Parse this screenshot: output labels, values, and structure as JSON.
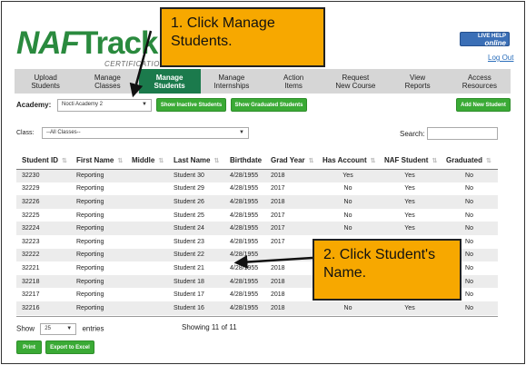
{
  "header": {
    "logo_naf": "NAF",
    "logo_track": "Track",
    "certification": "CERTIFICATION",
    "help_top": "LIVE HELP",
    "help_bottom": "online",
    "logout": "Log Out"
  },
  "nav": [
    {
      "line1": "Upload",
      "line2": "Students"
    },
    {
      "line1": "Manage",
      "line2": "Classes"
    },
    {
      "line1": "Manage",
      "line2": "Students",
      "active": true
    },
    {
      "line1": "Manage",
      "line2": "Internships"
    },
    {
      "line1": "Action",
      "line2": "Items"
    },
    {
      "line1": "Request",
      "line2": "New Course"
    },
    {
      "line1": "View",
      "line2": "Reports"
    },
    {
      "line1": "Access",
      "line2": "Resources"
    }
  ],
  "academy": {
    "label": "Academy:",
    "selected": "Nocti Academy 2",
    "show_inactive": "Show Inactive Students",
    "show_graduated": "Show Graduated Students",
    "add_new": "Add New Student"
  },
  "filters": {
    "class_label": "Class:",
    "class_selected": "--All Classes--",
    "search_label": "Search:"
  },
  "table": {
    "columns": [
      "Student ID",
      "First Name",
      "Middle",
      "Last Name",
      "Birthdate",
      "Grad Year",
      "Has Account",
      "NAF Student",
      "Graduated"
    ],
    "rows": [
      [
        "32230",
        "Reporting",
        "",
        "Student 30",
        "4/28/1955",
        "2018",
        "Yes",
        "Yes",
        "No"
      ],
      [
        "32229",
        "Reporting",
        "",
        "Student 29",
        "4/28/1955",
        "2017",
        "No",
        "Yes",
        "No"
      ],
      [
        "32226",
        "Reporting",
        "",
        "Student 26",
        "4/28/1955",
        "2018",
        "No",
        "Yes",
        "No"
      ],
      [
        "32225",
        "Reporting",
        "",
        "Student 25",
        "4/28/1955",
        "2017",
        "No",
        "Yes",
        "No"
      ],
      [
        "32224",
        "Reporting",
        "",
        "Student 24",
        "4/28/1955",
        "2017",
        "No",
        "Yes",
        "No"
      ],
      [
        "32223",
        "Reporting",
        "",
        "Student 23",
        "4/28/1955",
        "2017",
        "",
        "",
        "No"
      ],
      [
        "32222",
        "Reporting",
        "",
        "Student 22",
        "4/28/1955",
        "",
        "",
        "",
        "No"
      ],
      [
        "32221",
        "Reporting",
        "",
        "Student 21",
        "4/28/1955",
        "2018",
        "",
        "",
        "No"
      ],
      [
        "32218",
        "Reporting",
        "",
        "Student 18",
        "4/28/1955",
        "2018",
        "",
        "",
        "No"
      ],
      [
        "32217",
        "Reporting",
        "",
        "Student 17",
        "4/28/1955",
        "2018",
        "",
        "",
        "No"
      ],
      [
        "32216",
        "Reporting",
        "",
        "Student 16",
        "4/28/1955",
        "2018",
        "No",
        "Yes",
        "No"
      ]
    ]
  },
  "footer": {
    "show": "Show",
    "page_size": "25",
    "entries": "entries",
    "showing": "Showing 11 of 11",
    "print": "Print",
    "export": "Export to Excel"
  },
  "callouts": {
    "step1": "1. Click Manage Students.",
    "step2": "2. Click Student's Name."
  },
  "colors": {
    "brand_green": "#2a8a3e",
    "nav_active": "#1b7a4c",
    "button_green": "#3aaa35",
    "callout": "#f7a800"
  }
}
